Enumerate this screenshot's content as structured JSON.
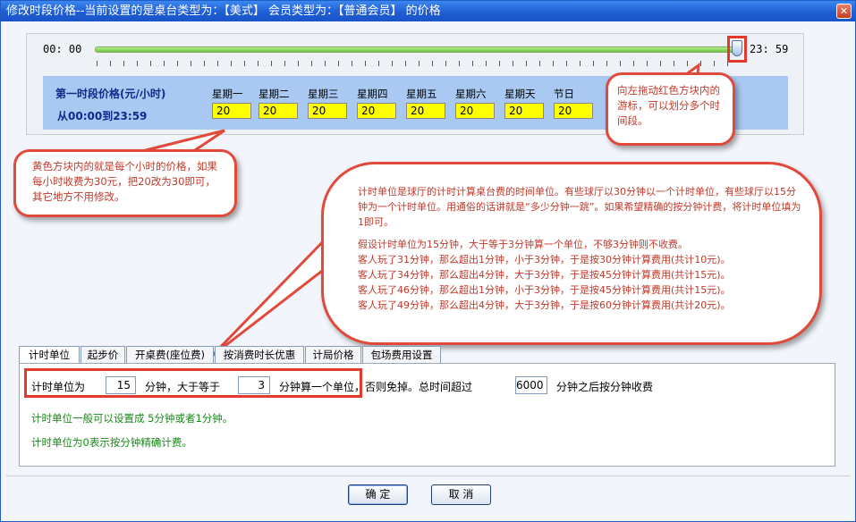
{
  "window": {
    "title": "修改时段价格--当前设置的是桌台类型为：【美式】 会员类型为：【普通会员】 的价格",
    "close_symbol": "✕"
  },
  "slider": {
    "start_time": "00: 00",
    "end_time": "23: 59"
  },
  "segment": {
    "title": "第一时段价格(元/小时)",
    "range": "从00:00到23:59",
    "days": [
      {
        "label": "星期一",
        "price": "20"
      },
      {
        "label": "星期二",
        "price": "20"
      },
      {
        "label": "星期三",
        "price": "20"
      },
      {
        "label": "星期四",
        "price": "20"
      },
      {
        "label": "星期五",
        "price": "20"
      },
      {
        "label": "星期六",
        "price": "20"
      },
      {
        "label": "星期天",
        "price": "20"
      },
      {
        "label": "节日",
        "price": "20"
      }
    ]
  },
  "callouts": {
    "slider_tip": "向左拖动红色方块内的游标，可以划分多个时间段。",
    "price_tip": "黄色方块内的就是每个小时的价格，如果每小时收费为30元，把20改为30即可，其它地方不用修改。",
    "unit_tip": [
      "计时单位是球厅的计时计算桌台费的时间单位。有些球厅以30分钟以一个计时单位，有些球厅以15分钟为一个计时单位。用通俗的话讲就是“多少分钟一跳”。如果希望精确的按分钟计费，将计时单位填为1即可。",
      "",
      "假设计时单位为15分钟，大于等于3分钟算一个单位，不够3分钟则不收费。",
      "客人玩了31分钟，那么超出1分钟，小于3分钟，于是按30分钟计算费用(共计10元)。",
      "客人玩了34分钟，那么超出4分钟，大于3分钟，于是按45分钟计算费用(共计15元)。",
      "客人玩了46分钟，那么超出1分钟，小于3分钟，于是按45分钟计算费用(共计15元)。",
      "客人玩了49分钟，那么超出4分钟，大于3分钟，于是按60分钟计算费用(共计20元)。"
    ]
  },
  "tabs": [
    "计时单位",
    "起步价",
    "开桌费(座位费)",
    "按消费时长优惠",
    "计局价格",
    "包场费用设置"
  ],
  "active_tab": "计时单位",
  "unit_settings": {
    "label_unit": "计时单位为",
    "unit_value": "15",
    "label_ge": "分钟，大于等于",
    "threshold_value": "3",
    "label_unit_rule": "分钟算一个单位，否则免掉。总时间超过",
    "total_value": "6000",
    "label_after": "分钟之后按分钟收费",
    "hint1": "计时单位一般可以设置成 5分钟或者1分钟。",
    "hint2": "计时单位为0表示按分钟精确计费。"
  },
  "buttons": {
    "ok": "确 定",
    "cancel": "取 消"
  },
  "colors": {
    "title_bar": "#1f5dd3",
    "price_band": "#a9c8f2",
    "price_field": "#ffff00",
    "callout_border": "#e1493b",
    "callout_text": "#c0392b",
    "hint_text": "#188a18"
  }
}
